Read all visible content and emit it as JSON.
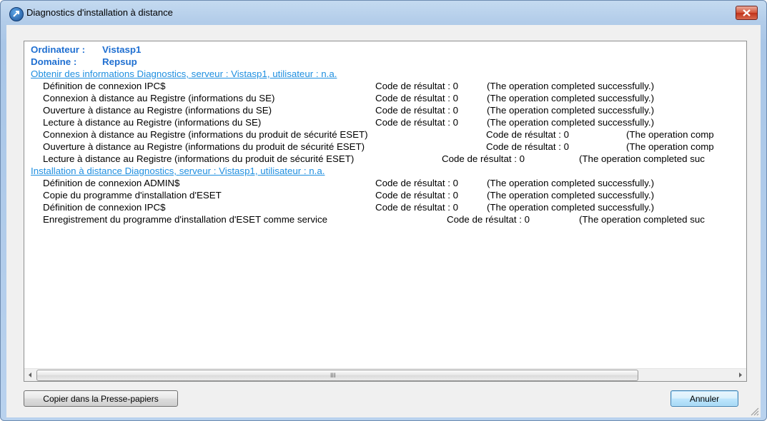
{
  "window": {
    "title": "Diagnostics d'installation à distance"
  },
  "info": {
    "computer_label": "Ordinateur :",
    "computer_value": "Vistasp1",
    "domain_label": "Domaine :",
    "domain_value": "Repsup"
  },
  "sections": [
    {
      "title": "Obtenir des informations Diagnostics, serveur : Vistasp1, utilisateur : n.a.",
      "rows": [
        {
          "desc": "Définition de connexion IPC$",
          "code": "Code de résultat : 0",
          "msg": "(The operation completed successfully.)"
        },
        {
          "desc": "Connexion à distance au Registre (informations du SE)",
          "code": "Code de résultat : 0",
          "msg": "(The operation completed successfully.)"
        },
        {
          "desc": "Ouverture à distance au Registre (informations du SE)",
          "code": "Code de résultat : 0",
          "msg": "(The operation completed successfully.)"
        },
        {
          "desc": "Lecture à distance au Registre (informations du SE)",
          "code": "Code de résultat : 0",
          "msg": "(The operation completed successfully.)"
        },
        {
          "desc": "Connexion à distance au Registre (informations du produit de sécurité ESET)",
          "code": "Code de résultat : 0",
          "msg": "(The operation comp"
        },
        {
          "desc": "Ouverture à distance au Registre (informations du produit de sécurité ESET)",
          "code": "Code de résultat : 0",
          "msg": "(The operation comp"
        },
        {
          "desc": "Lecture à distance au Registre (informations du produit de sécurité ESET)",
          "code": "Code de résultat : 0",
          "msg": "(The operation completed suc"
        }
      ]
    },
    {
      "title": "Installation à distance Diagnostics, serveur : Vistasp1, utilisateur : n.a.",
      "rows": [
        {
          "desc": "Définition de connexion ADMIN$",
          "code": "Code de résultat : 0",
          "msg": "(The operation completed successfully.)"
        },
        {
          "desc": "Copie du programme d'installation d'ESET",
          "code": "Code de résultat : 0",
          "msg": "(The operation completed successfully.)"
        },
        {
          "desc": "Définition de connexion IPC$",
          "code": "Code de résultat : 0",
          "msg": "(The operation completed successfully.)"
        },
        {
          "desc": "Enregistrement du programme d'installation d'ESET comme service",
          "code": "Code de résultat : 0",
          "msg": "(The operation completed suc"
        }
      ]
    }
  ],
  "buttons": {
    "copy_label": "Copier dans la Presse-papiers",
    "cancel_label": "Annuler"
  },
  "scrollbar": {
    "grip": "III"
  },
  "icons": {
    "app": "eset-remote-install-icon",
    "close": "close-icon",
    "scroll_left": "arrow-left-icon",
    "scroll_right": "arrow-right-icon",
    "resize": "resize-grip-icon"
  },
  "colors": {
    "link": "#1f8fe0",
    "info_text": "#1f6fd1",
    "close": "#c0321a"
  }
}
